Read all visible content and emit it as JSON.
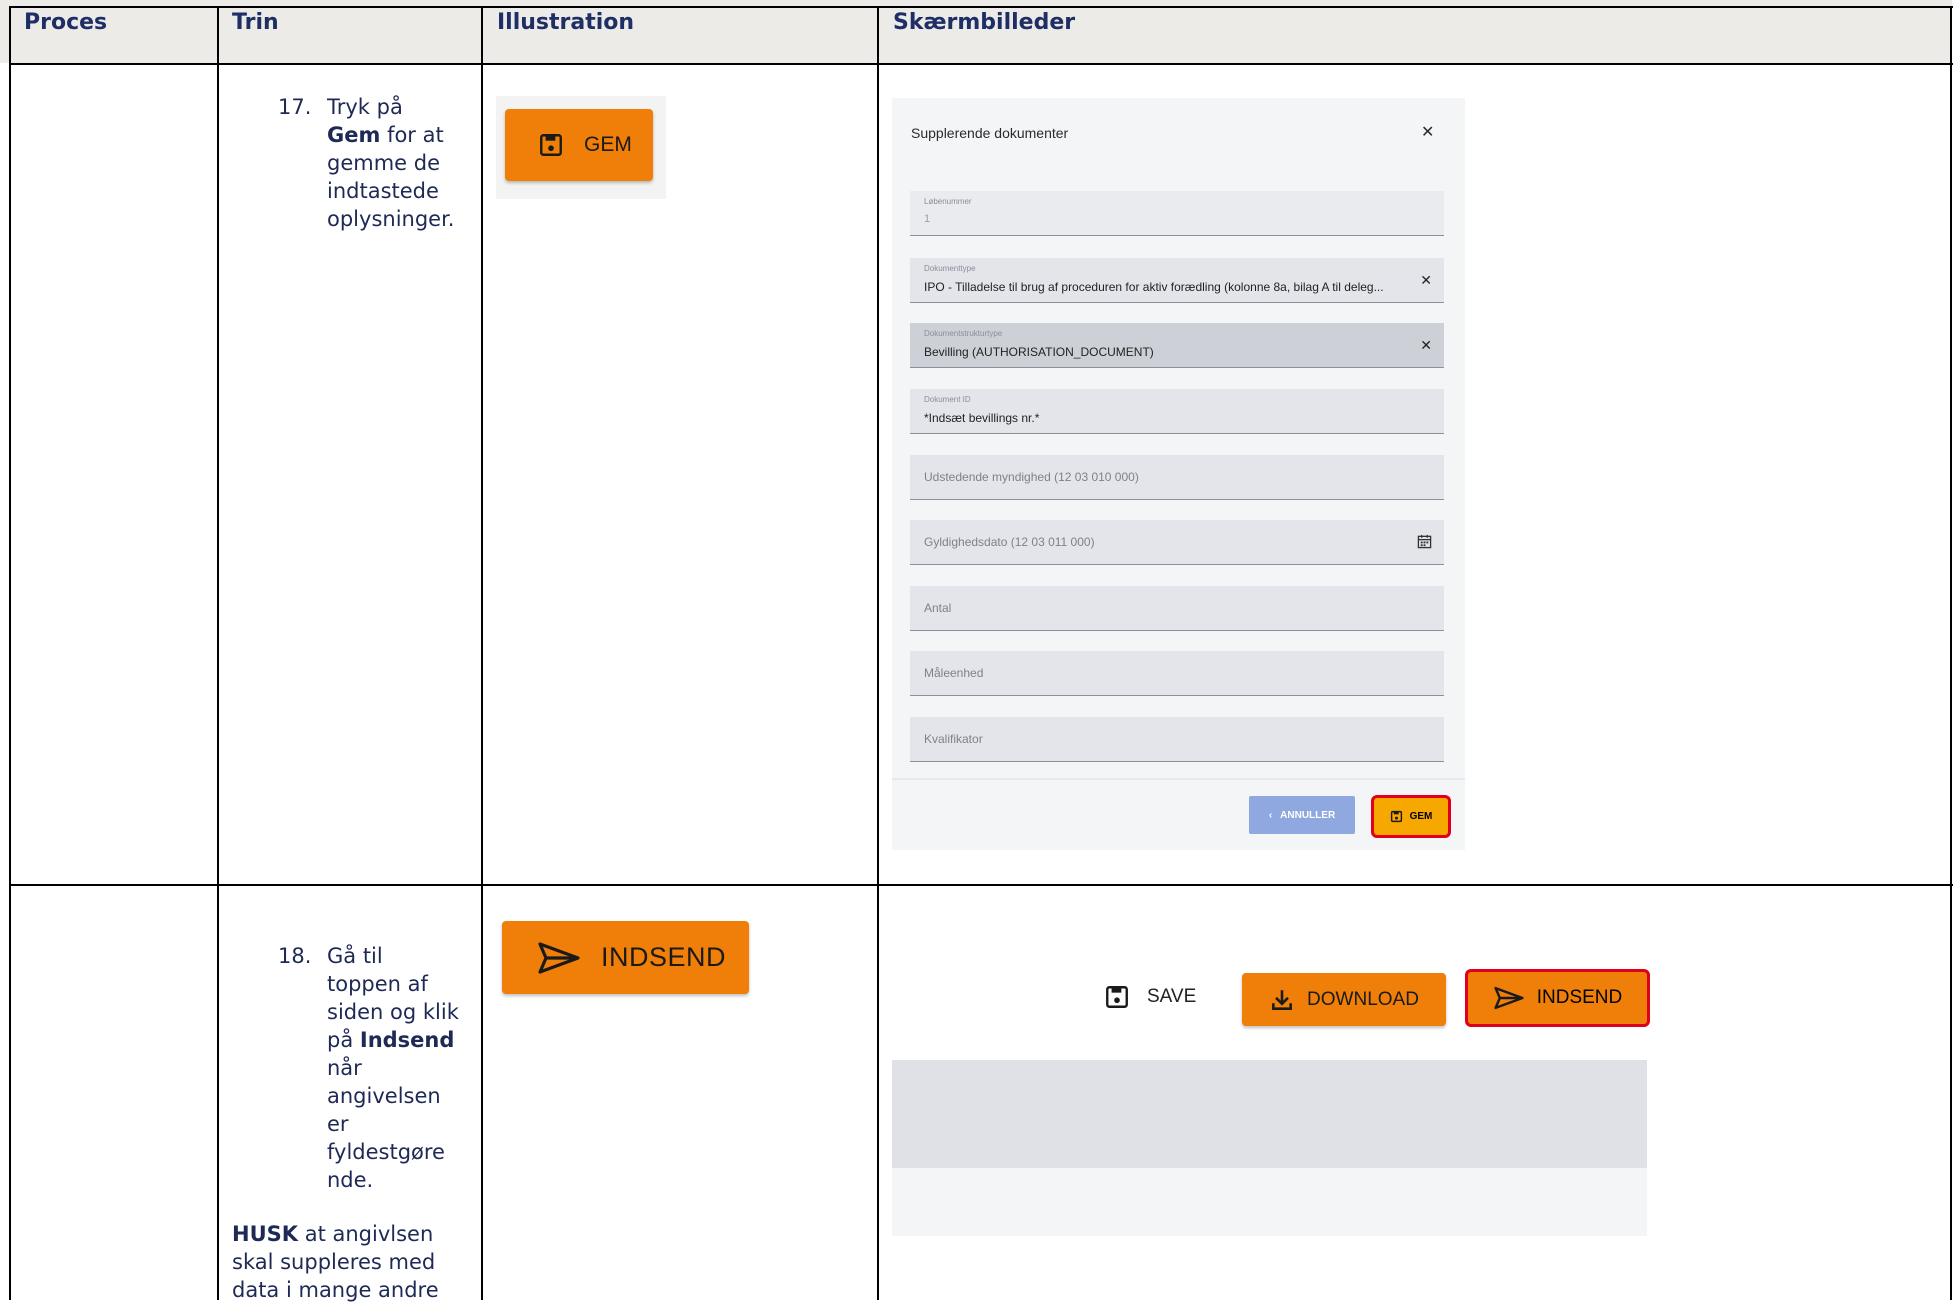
{
  "headers": {
    "proces": "Proces",
    "trin": "Trin",
    "illustration": "Illustration",
    "skaermbilleder": "Skærmbilleder"
  },
  "row17": {
    "number": "17.",
    "text_1": "Tryk på",
    "bold": "Gem",
    "text_2": "for at",
    "text_3": "gemme de",
    "text_4": "indtastede",
    "text_5": "oplysninger.",
    "illustration_button": "GEM",
    "dialog": {
      "title": "Supplerende dokumenter",
      "fields": [
        {
          "label": "Løbenummer",
          "value": "1"
        },
        {
          "label": "Dokumenttype",
          "value": "IPO - Tilladelse til brug af proceduren for aktiv forædling (kolonne 8a, bilag A til deleg..."
        },
        {
          "label": "Dokumentstrukturtype",
          "value": "Bevilling (AUTHORISATION_DOCUMENT)"
        },
        {
          "label": "Dokument ID",
          "value": "*Indsæt bevillings nr.*"
        },
        {
          "placeholder": "Udstedende myndighed (12 03 010 000)"
        },
        {
          "placeholder": "Gyldighedsdato (12 03 011 000)"
        },
        {
          "placeholder": "Antal"
        },
        {
          "placeholder": "Måleenhed"
        },
        {
          "placeholder": "Kvalifikator"
        }
      ],
      "cancel_label": "ANNULLER",
      "save_label": "GEM"
    }
  },
  "row18": {
    "number": "18.",
    "lines": [
      "Gå til",
      "toppen af",
      "siden og klik",
      "på",
      "Indsend",
      "når",
      "angivelsen",
      "er",
      "fyldestgøre",
      "nde."
    ],
    "husk_bold": "HUSK",
    "husk_lines": [
      "at angivlsen",
      "skal suppleres med",
      "data i mange andre"
    ],
    "illustration_button": "INDSEND",
    "toolbar": {
      "save_label": "SAVE",
      "download_label": "DOWNLOAD",
      "indsend_label": "INDSEND"
    }
  },
  "colors": {
    "header_bg": "#ecebe8",
    "orange": "#f07f09",
    "highlight_red": "#e0001b",
    "text_navy": "#1e2a55"
  },
  "icons": [
    "save-icon",
    "close-icon",
    "calendar-icon",
    "chevron-left-icon",
    "download-icon",
    "send-icon"
  ]
}
